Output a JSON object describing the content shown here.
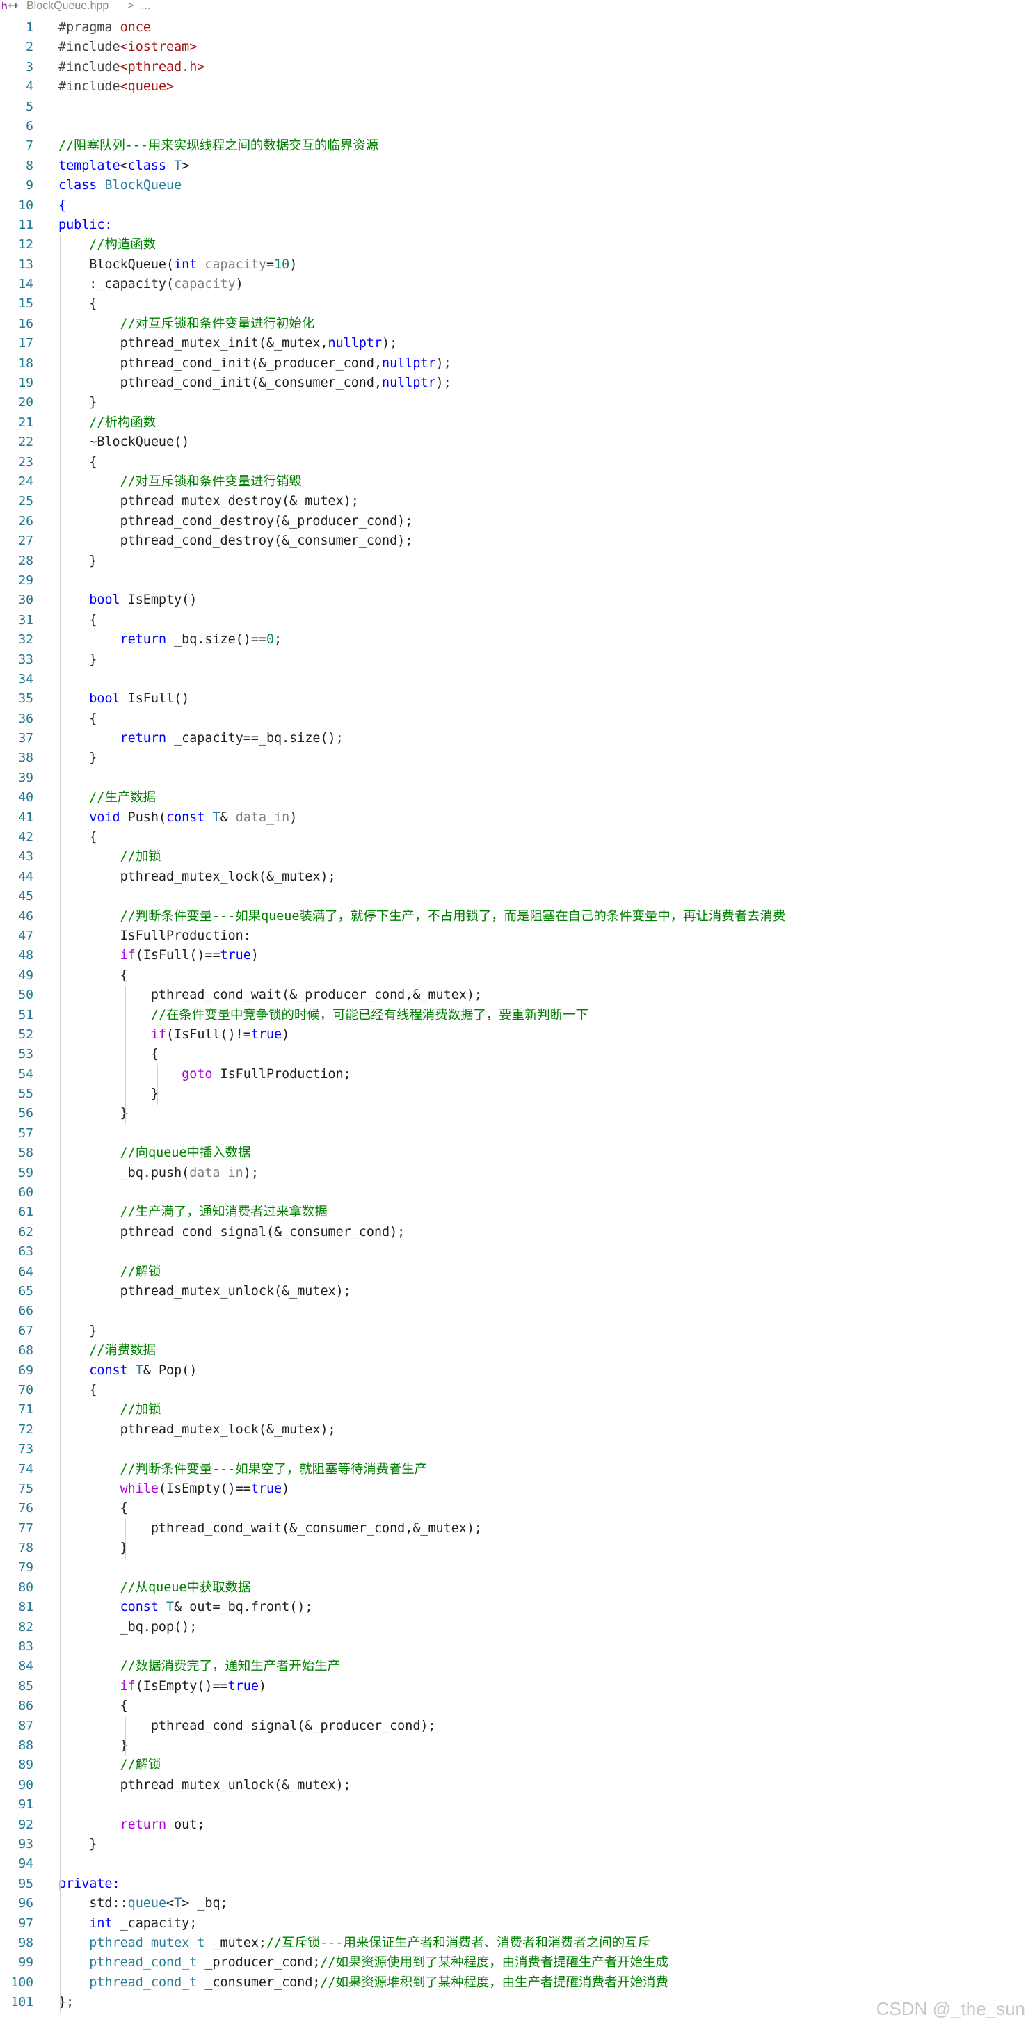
{
  "tab": {
    "file_name": "BlockQueue.hpp",
    "separator": ">",
    "more": "...",
    "file_icon": "h++"
  },
  "watermark": "CSDN @_the_sun",
  "colors": {
    "keyword": "#0000ff",
    "type": "#267f99",
    "string": "#a31515",
    "comment": "#008000",
    "number": "#098658",
    "control": "#af00db",
    "line_number": "#237893"
  },
  "lines": [
    [
      [
        "pp",
        "#pragma "
      ],
      [
        "s",
        "once"
      ]
    ],
    [
      [
        "pp",
        "#include"
      ],
      [
        "s",
        "<iostream>"
      ]
    ],
    [
      [
        "pp",
        "#include"
      ],
      [
        "s",
        "<pthread.h>"
      ]
    ],
    [
      [
        "pp",
        "#include"
      ],
      [
        "s",
        "<queue>"
      ]
    ],
    [],
    [],
    [
      [
        "cm",
        "//阻塞队列---用来实现线程之间的数据交互的临界资源"
      ]
    ],
    [
      [
        "k",
        "template"
      ],
      [
        "tx",
        "<"
      ],
      [
        "k",
        "class"
      ],
      [
        "tx",
        " "
      ],
      [
        "t",
        "T"
      ],
      [
        "tx",
        ">"
      ]
    ],
    [
      [
        "k",
        "class"
      ],
      [
        "tx",
        " "
      ],
      [
        "t",
        "BlockQueue"
      ]
    ],
    [
      [
        "k",
        "{"
      ]
    ],
    [
      [
        "k",
        "public:"
      ]
    ],
    [
      [
        "tx",
        "    "
      ],
      [
        "cm",
        "//构造函数"
      ]
    ],
    [
      [
        "tx",
        "    BlockQueue("
      ],
      [
        "k",
        "int"
      ],
      [
        "tx",
        " "
      ],
      [
        "pa",
        "capacity"
      ],
      [
        "tx",
        "="
      ],
      [
        "n",
        "10"
      ],
      [
        "tx",
        ")"
      ]
    ],
    [
      [
        "tx",
        "    :_capacity("
      ],
      [
        "pa",
        "capacity"
      ],
      [
        "tx",
        ")"
      ]
    ],
    [
      [
        "tx",
        "    {"
      ]
    ],
    [
      [
        "tx",
        "        "
      ],
      [
        "cm",
        "//对互斥锁和条件变量进行初始化"
      ]
    ],
    [
      [
        "tx",
        "        pthread_mutex_init(&_mutex,"
      ],
      [
        "k",
        "nullptr"
      ],
      [
        "tx",
        ");"
      ]
    ],
    [
      [
        "tx",
        "        pthread_cond_init(&_producer_cond,"
      ],
      [
        "k",
        "nullptr"
      ],
      [
        "tx",
        ");"
      ]
    ],
    [
      [
        "tx",
        "        pthread_cond_init(&_consumer_cond,"
      ],
      [
        "k",
        "nullptr"
      ],
      [
        "tx",
        ");"
      ]
    ],
    [
      [
        "tx",
        "    }"
      ]
    ],
    [
      [
        "tx",
        "    "
      ],
      [
        "cm",
        "//析构函数"
      ]
    ],
    [
      [
        "tx",
        "    ~BlockQueue()"
      ]
    ],
    [
      [
        "tx",
        "    {"
      ]
    ],
    [
      [
        "tx",
        "        "
      ],
      [
        "cm",
        "//对互斥锁和条件变量进行销毁"
      ]
    ],
    [
      [
        "tx",
        "        pthread_mutex_destroy(&_mutex);"
      ]
    ],
    [
      [
        "tx",
        "        pthread_cond_destroy(&_producer_cond);"
      ]
    ],
    [
      [
        "tx",
        "        pthread_cond_destroy(&_consumer_cond);"
      ]
    ],
    [
      [
        "tx",
        "    }"
      ]
    ],
    [],
    [
      [
        "tx",
        "    "
      ],
      [
        "k",
        "bool"
      ],
      [
        "tx",
        " IsEmpty()"
      ]
    ],
    [
      [
        "tx",
        "    {"
      ]
    ],
    [
      [
        "tx",
        "        "
      ],
      [
        "k",
        "return"
      ],
      [
        "tx",
        " _bq.size()=="
      ],
      [
        "n",
        "0"
      ],
      [
        "tx",
        ";"
      ]
    ],
    [
      [
        "tx",
        "    }"
      ]
    ],
    [],
    [
      [
        "tx",
        "    "
      ],
      [
        "k",
        "bool"
      ],
      [
        "tx",
        " IsFull()"
      ]
    ],
    [
      [
        "tx",
        "    {"
      ]
    ],
    [
      [
        "tx",
        "        "
      ],
      [
        "k",
        "return"
      ],
      [
        "tx",
        " _capacity==_bq.size();"
      ]
    ],
    [
      [
        "tx",
        "    }"
      ]
    ],
    [],
    [
      [
        "tx",
        "    "
      ],
      [
        "cm",
        "//生产数据"
      ]
    ],
    [
      [
        "tx",
        "    "
      ],
      [
        "k",
        "void"
      ],
      [
        "tx",
        " Push("
      ],
      [
        "k",
        "const"
      ],
      [
        "tx",
        " "
      ],
      [
        "t",
        "T"
      ],
      [
        "tx",
        "& "
      ],
      [
        "pa",
        "data_in"
      ],
      [
        "tx",
        ")"
      ]
    ],
    [
      [
        "tx",
        "    {"
      ]
    ],
    [
      [
        "tx",
        "        "
      ],
      [
        "cm",
        "//加锁"
      ]
    ],
    [
      [
        "tx",
        "        pthread_mutex_lock(&_mutex);"
      ]
    ],
    [],
    [
      [
        "tx",
        "        "
      ],
      [
        "cm",
        "//判断条件变量---如果queue装满了，就停下生产，不占用锁了，而是阻塞在自己的条件变量中，再让消费者去消费"
      ]
    ],
    [
      [
        "tx",
        "        IsFullProduction:"
      ]
    ],
    [
      [
        "tx",
        "        "
      ],
      [
        "ct",
        "if"
      ],
      [
        "tx",
        "(IsFull()=="
      ],
      [
        "k",
        "true"
      ],
      [
        "tx",
        ")"
      ]
    ],
    [
      [
        "tx",
        "        {"
      ]
    ],
    [
      [
        "tx",
        "            pthread_cond_wait(&_producer_cond,&_mutex);"
      ]
    ],
    [
      [
        "tx",
        "            "
      ],
      [
        "cm",
        "//在条件变量中竞争锁的时候，可能已经有线程消费数据了，要重新判断一下"
      ]
    ],
    [
      [
        "tx",
        "            "
      ],
      [
        "ct",
        "if"
      ],
      [
        "tx",
        "(IsFull()!="
      ],
      [
        "k",
        "true"
      ],
      [
        "tx",
        ")"
      ]
    ],
    [
      [
        "tx",
        "            {"
      ]
    ],
    [
      [
        "tx",
        "                "
      ],
      [
        "ct",
        "goto"
      ],
      [
        "tx",
        " IsFullProduction;"
      ]
    ],
    [
      [
        "tx",
        "            }"
      ]
    ],
    [
      [
        "tx",
        "        }"
      ]
    ],
    [],
    [
      [
        "tx",
        "        "
      ],
      [
        "cm",
        "//向queue中插入数据"
      ]
    ],
    [
      [
        "tx",
        "        _bq.push("
      ],
      [
        "pa",
        "data_in"
      ],
      [
        "tx",
        ");"
      ]
    ],
    [],
    [
      [
        "tx",
        "        "
      ],
      [
        "cm",
        "//生产满了，通知消费者过来拿数据"
      ]
    ],
    [
      [
        "tx",
        "        pthread_cond_signal(&_consumer_cond);"
      ]
    ],
    [],
    [
      [
        "tx",
        "        "
      ],
      [
        "cm",
        "//解锁"
      ]
    ],
    [
      [
        "tx",
        "        pthread_mutex_unlock(&_mutex);"
      ]
    ],
    [],
    [
      [
        "tx",
        "    }"
      ]
    ],
    [
      [
        "tx",
        "    "
      ],
      [
        "cm",
        "//消费数据"
      ]
    ],
    [
      [
        "tx",
        "    "
      ],
      [
        "k",
        "const"
      ],
      [
        "tx",
        " "
      ],
      [
        "t",
        "T"
      ],
      [
        "tx",
        "& Pop()"
      ]
    ],
    [
      [
        "tx",
        "    {"
      ]
    ],
    [
      [
        "tx",
        "        "
      ],
      [
        "cm",
        "//加锁"
      ]
    ],
    [
      [
        "tx",
        "        pthread_mutex_lock(&_mutex);"
      ]
    ],
    [],
    [
      [
        "tx",
        "        "
      ],
      [
        "cm",
        "//判断条件变量---如果空了，就阻塞等待消费者生产"
      ]
    ],
    [
      [
        "tx",
        "        "
      ],
      [
        "ct",
        "while"
      ],
      [
        "tx",
        "(IsEmpty()=="
      ],
      [
        "k",
        "true"
      ],
      [
        "tx",
        ")"
      ]
    ],
    [
      [
        "tx",
        "        {"
      ]
    ],
    [
      [
        "tx",
        "            pthread_cond_wait(&_consumer_cond,&_mutex);"
      ]
    ],
    [
      [
        "tx",
        "        }"
      ]
    ],
    [],
    [
      [
        "tx",
        "        "
      ],
      [
        "cm",
        "//从queue中获取数据"
      ]
    ],
    [
      [
        "tx",
        "        "
      ],
      [
        "k",
        "const"
      ],
      [
        "tx",
        " "
      ],
      [
        "t",
        "T"
      ],
      [
        "tx",
        "& out=_bq.front();"
      ]
    ],
    [
      [
        "tx",
        "        _bq.pop();"
      ]
    ],
    [],
    [
      [
        "tx",
        "        "
      ],
      [
        "cm",
        "//数据消费完了，通知生产者开始生产"
      ]
    ],
    [
      [
        "tx",
        "        "
      ],
      [
        "ct",
        "if"
      ],
      [
        "tx",
        "(IsEmpty()=="
      ],
      [
        "k",
        "true"
      ],
      [
        "tx",
        ")"
      ]
    ],
    [
      [
        "tx",
        "        {"
      ]
    ],
    [
      [
        "tx",
        "            pthread_cond_signal(&_producer_cond);"
      ]
    ],
    [
      [
        "tx",
        "        }"
      ]
    ],
    [
      [
        "tx",
        "        "
      ],
      [
        "cm",
        "//解锁"
      ]
    ],
    [
      [
        "tx",
        "        pthread_mutex_unlock(&_mutex);"
      ]
    ],
    [],
    [
      [
        "tx",
        "        "
      ],
      [
        "ct",
        "return"
      ],
      [
        "tx",
        " out;"
      ]
    ],
    [
      [
        "tx",
        "    }"
      ]
    ],
    [],
    [
      [
        "k",
        "private:"
      ]
    ],
    [
      [
        "tx",
        "    std::"
      ],
      [
        "t",
        "queue"
      ],
      [
        "tx",
        "<"
      ],
      [
        "t",
        "T"
      ],
      [
        "tx",
        "> _bq;"
      ]
    ],
    [
      [
        "tx",
        "    "
      ],
      [
        "k",
        "int"
      ],
      [
        "tx",
        " _capacity;"
      ]
    ],
    [
      [
        "tx",
        "    "
      ],
      [
        "t",
        "pthread_mutex_t"
      ],
      [
        "tx",
        " _mutex;"
      ],
      [
        "cm",
        "//互斥锁---用来保证生产者和消费者、消费者和消费者之间的互斥"
      ]
    ],
    [
      [
        "tx",
        "    "
      ],
      [
        "t",
        "pthread_cond_t"
      ],
      [
        "tx",
        " _producer_cond;"
      ],
      [
        "cm",
        "//如果资源使用到了某种程度，由消费者提醒生产者开始生成"
      ]
    ],
    [
      [
        "tx",
        "    "
      ],
      [
        "t",
        "pthread_cond_t"
      ],
      [
        "tx",
        " _consumer_cond;"
      ],
      [
        "cm",
        "//如果资源堆积到了某种程度，由生产者提醒消费者开始消费"
      ]
    ],
    [
      [
        "tx",
        "};"
      ]
    ]
  ]
}
